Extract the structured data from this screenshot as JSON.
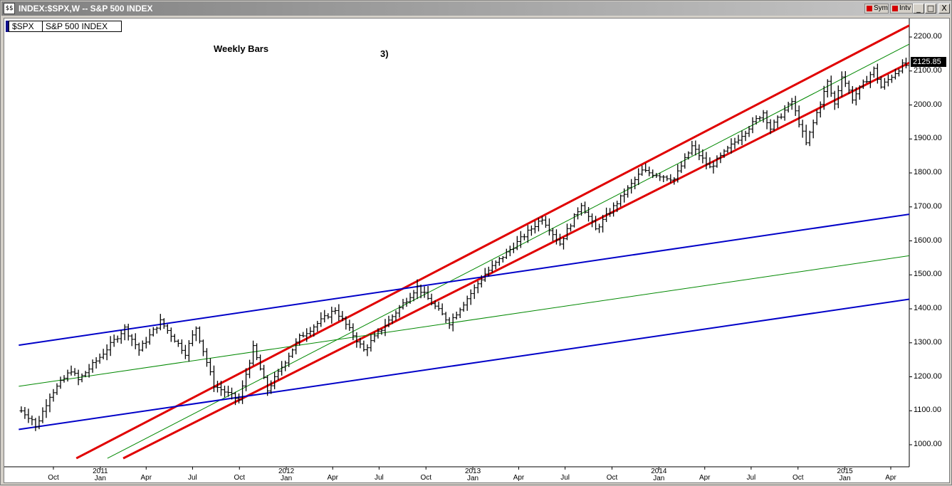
{
  "window": {
    "title": "INDEX:$SPX,W -- S&P 500 INDEX",
    "icon_label": "$$",
    "sym_toggle": "Sym",
    "intv_toggle": "Intv",
    "minimize": "_",
    "restore": "□",
    "close": "X"
  },
  "legend": {
    "symbol": "$SPX",
    "name": "S&P 500 INDEX"
  },
  "annotations": {
    "weekly": "Weekly Bars",
    "number": "3)"
  },
  "colors": {
    "price_bars": "#000000",
    "red_channel": "#e00000",
    "green_line": "#008800",
    "blue_channel": "#0000c8",
    "axis_box": "#000000"
  },
  "chart_data": {
    "type": "ohlc",
    "bar_interval": "weekly",
    "last_price": "2125.85",
    "y_ticks": [
      "2200.00",
      "2100.00",
      "2000.00",
      "1900.00",
      "1800.00",
      "1700.00",
      "1600.00",
      "1500.00",
      "1400.00",
      "1300.00",
      "1200.00",
      "1100.00",
      "1000.00"
    ],
    "ylim": [
      960,
      2260
    ],
    "x_ticks": [
      {
        "top": "",
        "bottom": "Oct",
        "date": "2010-10-01"
      },
      {
        "top": "2011",
        "bottom": "Jan",
        "date": "2011-01-01"
      },
      {
        "top": "",
        "bottom": "Apr",
        "date": "2011-04-01"
      },
      {
        "top": "",
        "bottom": "Jul",
        "date": "2011-07-01"
      },
      {
        "top": "",
        "bottom": "Oct",
        "date": "2011-10-01"
      },
      {
        "top": "2012",
        "bottom": "Jan",
        "date": "2012-01-01"
      },
      {
        "top": "",
        "bottom": "Apr",
        "date": "2012-04-01"
      },
      {
        "top": "",
        "bottom": "Jul",
        "date": "2012-07-01"
      },
      {
        "top": "",
        "bottom": "Oct",
        "date": "2012-10-01"
      },
      {
        "top": "2013",
        "bottom": "Jan",
        "date": "2013-01-01"
      },
      {
        "top": "",
        "bottom": "Apr",
        "date": "2013-04-01"
      },
      {
        "top": "",
        "bottom": "Jul",
        "date": "2013-07-01"
      },
      {
        "top": "",
        "bottom": "Oct",
        "date": "2013-10-01"
      },
      {
        "top": "2014",
        "bottom": "Jan",
        "date": "2014-01-01"
      },
      {
        "top": "",
        "bottom": "Apr",
        "date": "2014-04-01"
      },
      {
        "top": "",
        "bottom": "Jul",
        "date": "2014-07-01"
      },
      {
        "top": "",
        "bottom": "Oct",
        "date": "2014-10-01"
      },
      {
        "top": "2015",
        "bottom": "Jan",
        "date": "2015-01-01"
      },
      {
        "top": "",
        "bottom": "Apr",
        "date": "2015-04-01"
      }
    ],
    "price_path": [
      [
        "2010-07-30",
        1100
      ],
      [
        "2010-08-20",
        1075
      ],
      [
        "2010-08-27",
        1050
      ],
      [
        "2010-09-24",
        1145
      ],
      [
        "2010-11-05",
        1220
      ],
      [
        "2010-11-19",
        1190
      ],
      [
        "2010-12-31",
        1258
      ],
      [
        "2011-02-18",
        1343
      ],
      [
        "2011-03-18",
        1279
      ],
      [
        "2011-04-29",
        1363
      ],
      [
        "2011-06-17",
        1270
      ],
      [
        "2011-07-08",
        1345
      ],
      [
        "2011-08-12",
        1175
      ],
      [
        "2011-09-30",
        1131
      ],
      [
        "2011-10-28",
        1285
      ],
      [
        "2011-11-25",
        1160
      ],
      [
        "2012-01-27",
        1316
      ],
      [
        "2012-04-06",
        1398
      ],
      [
        "2012-06-01",
        1278
      ],
      [
        "2012-09-14",
        1465
      ],
      [
        "2012-11-16",
        1359
      ],
      [
        "2013-01-25",
        1503
      ],
      [
        "2013-05-17",
        1667
      ],
      [
        "2013-06-21",
        1592
      ],
      [
        "2013-08-02",
        1709
      ],
      [
        "2013-08-30",
        1633
      ],
      [
        "2013-11-29",
        1806
      ],
      [
        "2014-01-31",
        1782
      ],
      [
        "2014-03-07",
        1878
      ],
      [
        "2014-04-11",
        1815
      ],
      [
        "2014-07-25",
        1978
      ],
      [
        "2014-08-08",
        1931
      ],
      [
        "2014-09-19",
        2010
      ],
      [
        "2014-10-17",
        1886
      ],
      [
        "2014-11-28",
        2067
      ],
      [
        "2014-12-12",
        2002
      ],
      [
        "2014-12-26",
        2088
      ],
      [
        "2015-01-16",
        2019
      ],
      [
        "2015-02-27",
        2104
      ],
      [
        "2015-03-13",
        2053
      ],
      [
        "2015-04-24",
        2117
      ],
      [
        "2015-05-08",
        2116
      ]
    ],
    "trendlines": [
      {
        "name": "red upper",
        "color": "red",
        "width": 3,
        "from": [
          "2010-11-15",
          960
        ],
        "to": [
          "2015-05-15",
          2240
        ]
      },
      {
        "name": "red lower",
        "color": "red",
        "width": 3,
        "from": [
          "2011-02-15",
          960
        ],
        "to": [
          "2015-05-15",
          2130
        ]
      },
      {
        "name": "green channel mid",
        "color": "green",
        "width": 1,
        "from": [
          "2011-01-15",
          960
        ],
        "to": [
          "2015-05-15",
          2185
        ]
      },
      {
        "name": "blue upper",
        "color": "blue",
        "width": 2,
        "from": [
          "2010-07-25",
          1293
        ],
        "to": [
          "2015-05-15",
          1680
        ]
      },
      {
        "name": "blue lower",
        "color": "blue",
        "width": 2,
        "from": [
          "2010-07-25",
          1045
        ],
        "to": [
          "2015-05-15",
          1430
        ]
      },
      {
        "name": "green mid",
        "color": "green",
        "width": 1,
        "from": [
          "2010-07-25",
          1172
        ],
        "to": [
          "2015-05-15",
          1558
        ]
      }
    ]
  }
}
